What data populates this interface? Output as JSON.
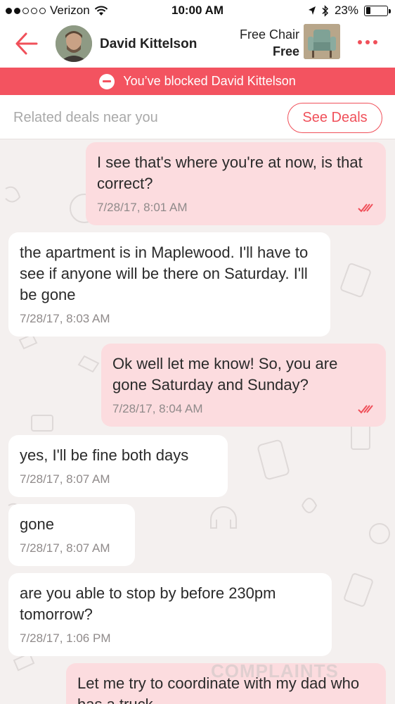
{
  "status_bar": {
    "carrier": "Verizon",
    "time": "10:00 AM",
    "battery": "23%",
    "battery_level": 0.23,
    "signal_bars": 2,
    "icons": [
      "wifi-icon",
      "location-arrow-icon",
      "bluetooth-icon",
      "battery-icon"
    ]
  },
  "header": {
    "contact_name": "David Kittelson",
    "item_title": "Free Chair",
    "item_price": "Free",
    "back_icon": "arrow-left-icon",
    "more_icon": "more-dots-icon"
  },
  "banner": {
    "text": "You’ve blocked David Kittelson",
    "icon": "blocked-icon"
  },
  "deals": {
    "text": "Related deals near you",
    "button_label": "See Deals"
  },
  "messages": [
    {
      "direction": "out",
      "text": "I see that's where you're at now, is that correct?",
      "time": "7/28/17, 8:01 AM",
      "read": true
    },
    {
      "direction": "in",
      "text": "the apartment is in Maplewood. I'll have to see if anyone will be there on Saturday. I'll be gone",
      "time": "7/28/17, 8:03 AM"
    },
    {
      "direction": "out",
      "text": "Ok well let me know! So, you are gone Saturday and Sunday?",
      "time": "7/28/17, 8:04 AM",
      "read": true
    },
    {
      "direction": "in",
      "text": "yes, I'll be fine both days",
      "time": "7/28/17, 8:07 AM"
    },
    {
      "direction": "in",
      "text": "gone",
      "time": "7/28/17, 8:07 AM"
    },
    {
      "direction": "in",
      "text": "are you able to stop by before 230pm tomorrow?",
      "time": "7/28/17, 1:06 PM"
    },
    {
      "direction": "out",
      "text": "Let me try to coordinate with my dad who has a truck",
      "time": ""
    }
  ],
  "watermark": "COMPLAINTS",
  "colors": {
    "accent": "#f0505a",
    "banner": "#f35360",
    "outgoing_bubble": "#fcdcdf",
    "incoming_bubble": "#ffffff",
    "chat_background": "#f4f0ef"
  }
}
